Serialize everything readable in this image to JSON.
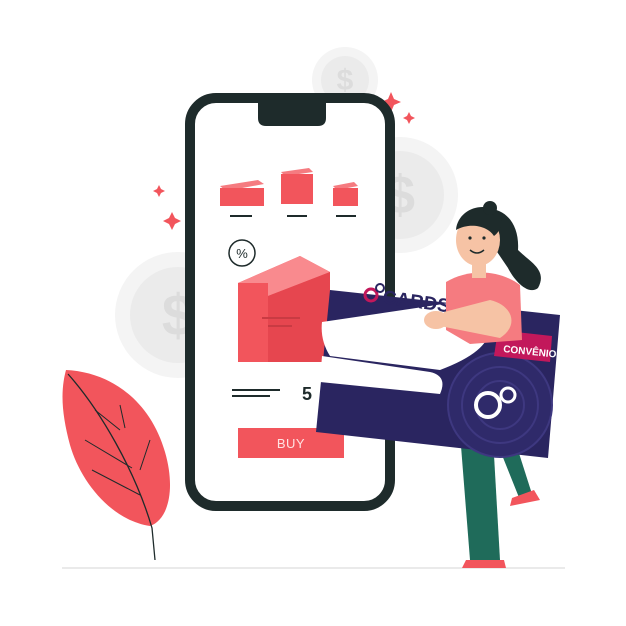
{
  "illustration": {
    "percent_badge": "%",
    "price_fragment": "5",
    "buy_button_label": "BUY",
    "card_brand": "CARDS",
    "card_tag": "CONVÊNIO",
    "coin_symbol": "$"
  },
  "colors": {
    "accent_red": "#f2555c",
    "dark_outline": "#1e2b2b",
    "card_navy": "#2a2560",
    "card_magenta": "#c2185b",
    "skin": "#f6c3a5",
    "pants_teal": "#1f6b5a",
    "coin_gray": "#f0f0f0"
  }
}
